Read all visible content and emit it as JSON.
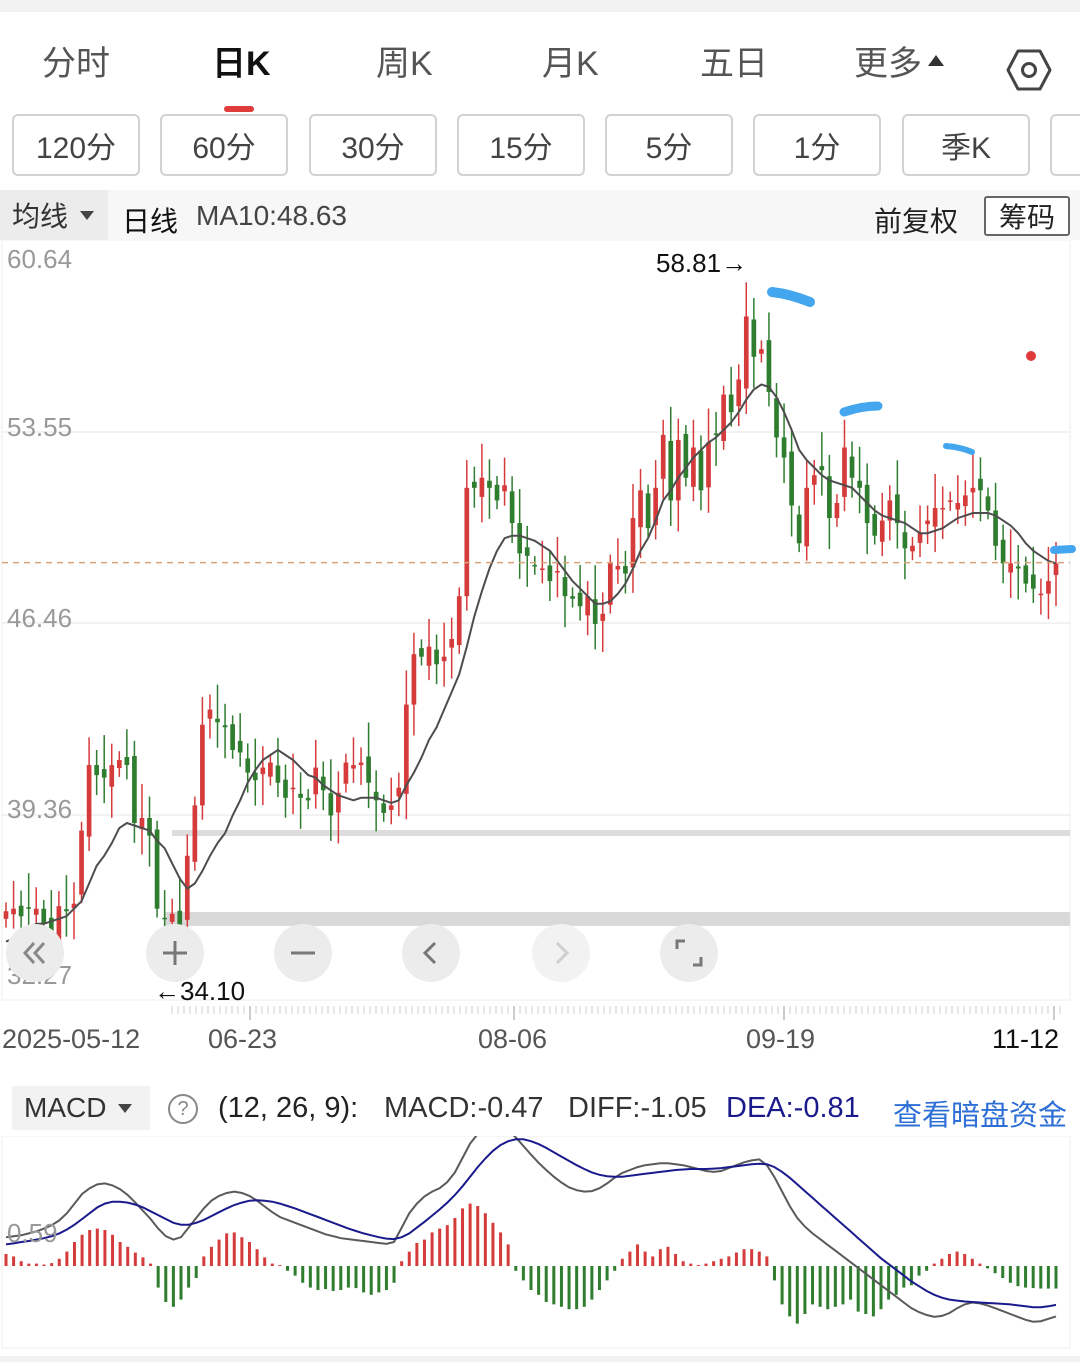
{
  "tabs": [
    {
      "label": "分时"
    },
    {
      "label": "日K",
      "active": true
    },
    {
      "label": "周K"
    },
    {
      "label": "月K"
    },
    {
      "label": "五日"
    },
    {
      "label": "更多"
    }
  ],
  "periods": [
    "120分",
    "60分",
    "30分",
    "15分",
    "5分",
    "1分",
    "季K"
  ],
  "info": {
    "select_label": "均线",
    "kline_label": "日线",
    "ma_label": "MA10:48.63",
    "adjust_label": "前复权",
    "chips_label": "筹码"
  },
  "macd": {
    "select_label": "MACD",
    "params": "(12, 26, 9):",
    "macd_value": "MACD:-0.47",
    "diff_value": "DIFF:-1.05",
    "dea_value": "DEA:-0.81",
    "link_label": "查看暗盘资金"
  },
  "colors": {
    "up": "#d63b3b",
    "down": "#2f7d2f",
    "ma": "#4d4d4d",
    "dea": "#1a1a8c",
    "link": "#2d6fd6",
    "marker": "#44a6ee"
  },
  "icons": {
    "settings": "hexagon-gear-icon",
    "rewind": "double-left-icon",
    "zoom_in": "plus-icon",
    "zoom_out": "minus-icon",
    "prev": "left-icon",
    "next": "right-icon",
    "fullscreen": "fullscreen-icon"
  },
  "chart_data": [
    {
      "type": "candlestick",
      "title": "日K",
      "y_tick_labels": [
        "60.64",
        "53.55",
        "46.46",
        "39.36",
        "32.27"
      ],
      "ylim": [
        32.27,
        60.64
      ],
      "x_tick_labels": [
        "2025-05-12",
        "06-23",
        "08-06",
        "09-19",
        "11-12"
      ],
      "annotations": {
        "high": "58.81→",
        "low": "←34.10",
        "high_value": 58.81,
        "low_value": 34.1
      },
      "last_close": 48.63,
      "ma10_last": 48.63,
      "closes": [
        34.8,
        34.9,
        34.6,
        34.9,
        34.9,
        34.3,
        34.0,
        35.0,
        34.8,
        35.1,
        38.0,
        40.6,
        40.2,
        40.1,
        40.6,
        40.8,
        40.6,
        38.3,
        38.5,
        37.8,
        34.9,
        34.5,
        34.7,
        34.1,
        37.0,
        39.0,
        42.2,
        42.8,
        42.3,
        42.1,
        41.2,
        41.1,
        40.3,
        40.0,
        40.5,
        40.7,
        39.9,
        39.3,
        39.7,
        39.3,
        39.2,
        40.5,
        39.6,
        38.6,
        39.5,
        40.7,
        40.6,
        40.7,
        39.9,
        39.2,
        38.7,
        39.0,
        39.7,
        43.0,
        45.0,
        44.9,
        45.3,
        44.6,
        44.9,
        45.6,
        47.3,
        51.6,
        51.6,
        52.0,
        51.6,
        51.1,
        51.7,
        50.2,
        49.0,
        48.9,
        48.5,
        48.4,
        47.9,
        48.3,
        47.3,
        47.2,
        46.9,
        47.3,
        46.2,
        46.6,
        48.6,
        48.5,
        48.2,
        50.4,
        51.5,
        50.0,
        51.6,
        53.7,
        51.1,
        53.5,
        52.0,
        53.2,
        51.5,
        53.4,
        53.7,
        55.3,
        54.6,
        55.9,
        58.4,
        56.8,
        57.1,
        55.4,
        53.6,
        52.8,
        50.9,
        49.4,
        51.6,
        52.1,
        52.3,
        50.4,
        51.0,
        53.2,
        52.0,
        51.6,
        50.2,
        49.7,
        50.3,
        51.1,
        50.2,
        49.2,
        49.3,
        49.8,
        50.3,
        50.8,
        50.8,
        51.1,
        51.0,
        51.3,
        51.6,
        51.5,
        50.7,
        49.3,
        48.6,
        48.6,
        48.4,
        47.8,
        47.6,
        47.4,
        47.9,
        48.6
      ],
      "ma10": [
        33.6,
        33.7,
        33.9,
        34.1,
        34.3,
        34.3,
        34.4,
        34.5,
        34.6,
        34.9,
        35.2,
        35.9,
        36.6,
        37.0,
        37.5,
        38.1,
        38.3,
        38.2,
        38.1,
        38.0,
        37.6,
        37.3,
        36.7,
        36.1,
        35.7,
        35.9,
        36.4,
        37.0,
        37.5,
        37.9,
        38.6,
        39.2,
        39.9,
        40.4,
        40.8,
        41.0,
        41.2,
        41.0,
        40.8,
        40.5,
        40.2,
        40.1,
        39.8,
        39.6,
        39.4,
        39.3,
        39.2,
        39.3,
        39.3,
        39.3,
        39.2,
        39.1,
        39.2,
        39.8,
        40.3,
        40.9,
        41.6,
        42.1,
        42.8,
        43.5,
        44.2,
        45.3,
        46.5,
        47.5,
        48.4,
        49.1,
        49.6,
        49.7,
        49.7,
        49.6,
        49.5,
        49.3,
        49.1,
        48.7,
        48.3,
        47.9,
        47.6,
        47.3,
        47.0,
        47.0,
        47.1,
        47.4,
        47.8,
        48.4,
        49.1,
        49.6,
        50.3,
        51.1,
        51.5,
        52.0,
        52.4,
        52.8,
        53.1,
        53.4,
        53.6,
        53.9,
        54.2,
        54.6,
        55.1,
        55.5,
        55.7,
        55.6,
        55.2,
        54.6,
        53.9,
        53.1,
        52.7,
        52.4,
        52.1,
        51.9,
        51.8,
        51.7,
        51.6,
        51.3,
        51.0,
        50.7,
        50.5,
        50.4,
        50.3,
        50.2,
        50.0,
        49.8,
        49.8,
        49.9,
        50.0,
        50.2,
        50.4,
        50.5,
        50.6,
        50.6,
        50.6,
        50.5,
        50.3,
        50.1,
        49.8,
        49.4,
        49.1,
        48.9,
        48.7,
        48.6
      ],
      "series": [
        {
          "name": "MA10",
          "values_key": "ma10"
        }
      ]
    },
    {
      "type": "bar+line",
      "title": "MACD",
      "y_tick_labels": [
        "0.59"
      ],
      "series": [
        {
          "name": "MACD",
          "last": -0.47
        },
        {
          "name": "DIFF",
          "last": -1.05
        },
        {
          "name": "DEA",
          "last": -0.81
        }
      ],
      "macd_hist": [
        0.25,
        0.2,
        0.1,
        0.05,
        0.05,
        0.03,
        0.06,
        0.15,
        0.3,
        0.5,
        0.65,
        0.75,
        0.78,
        0.75,
        0.65,
        0.5,
        0.4,
        0.28,
        0.18,
        0.05,
        -0.45,
        -0.75,
        -0.85,
        -0.7,
        -0.45,
        -0.25,
        0.2,
        0.4,
        0.55,
        0.68,
        0.7,
        0.6,
        0.5,
        0.35,
        0.18,
        0.05,
        0.02,
        -0.1,
        -0.2,
        -0.35,
        -0.45,
        -0.5,
        -0.48,
        -0.52,
        -0.5,
        -0.45,
        -0.46,
        -0.55,
        -0.6,
        -0.55,
        -0.5,
        -0.35,
        0.1,
        0.3,
        0.48,
        0.55,
        0.7,
        0.78,
        0.85,
        1.0,
        1.2,
        1.3,
        1.25,
        1.1,
        0.9,
        0.7,
        0.45,
        -0.1,
        -0.3,
        -0.5,
        -0.6,
        -0.75,
        -0.8,
        -0.85,
        -0.9,
        -0.9,
        -0.85,
        -0.7,
        -0.5,
        -0.3,
        -0.1,
        0.15,
        0.3,
        0.45,
        0.3,
        0.2,
        0.35,
        0.4,
        0.25,
        0.1,
        0.05,
        0.02,
        0.05,
        0.1,
        0.15,
        0.2,
        0.28,
        0.35,
        0.35,
        0.3,
        0.2,
        -0.3,
        -0.8,
        -1.05,
        -1.2,
        -1.0,
        -0.8,
        -0.85,
        -0.9,
        -0.85,
        -0.8,
        -0.7,
        -0.95,
        -1.0,
        -1.05,
        -0.9,
        -0.7,
        -0.6,
        -0.45,
        -0.4,
        -0.2,
        -0.1,
        0.05,
        0.15,
        0.25,
        0.3,
        0.25,
        0.15,
        0.05,
        -0.05,
        -0.15,
        -0.25,
        -0.35,
        -0.42,
        -0.45,
        -0.46,
        -0.47,
        -0.47,
        -0.47
      ],
      "diff": [
        0.6,
        0.62,
        0.64,
        0.68,
        0.72,
        0.78,
        0.85,
        0.95,
        1.1,
        1.3,
        1.5,
        1.62,
        1.7,
        1.72,
        1.68,
        1.6,
        1.48,
        1.32,
        1.15,
        0.98,
        0.78,
        0.62,
        0.55,
        0.6,
        0.8,
        1.0,
        1.2,
        1.36,
        1.46,
        1.52,
        1.55,
        1.52,
        1.46,
        1.36,
        1.24,
        1.12,
        1.02,
        0.96,
        0.9,
        0.84,
        0.78,
        0.72,
        0.66,
        0.62,
        0.58,
        0.56,
        0.54,
        0.52,
        0.5,
        0.48,
        0.46,
        0.5,
        0.8,
        1.1,
        1.3,
        1.45,
        1.55,
        1.62,
        1.75,
        1.95,
        2.25,
        2.55,
        2.75,
        2.88,
        2.92,
        2.9,
        2.82,
        2.68,
        2.5,
        2.32,
        2.15,
        2.0,
        1.86,
        1.74,
        1.64,
        1.58,
        1.55,
        1.56,
        1.62,
        1.72,
        1.84,
        1.94,
        2.0,
        2.06,
        2.1,
        2.12,
        2.14,
        2.14,
        2.12,
        2.1,
        2.06,
        2.02,
        1.98,
        1.96,
        1.98,
        2.04,
        2.1,
        2.16,
        2.2,
        2.22,
        2.1,
        1.85,
        1.55,
        1.25,
        1.0,
        0.82,
        0.68,
        0.56,
        0.44,
        0.32,
        0.2,
        0.08,
        -0.04,
        -0.16,
        -0.28,
        -0.4,
        -0.52,
        -0.64,
        -0.76,
        -0.88,
        -0.96,
        -1.02,
        -1.06,
        -1.04,
        -0.98,
        -0.88,
        -0.8,
        -0.76,
        -0.78,
        -0.82,
        -0.88,
        -0.94,
        -1.0,
        -1.06,
        -1.12,
        -1.16,
        -1.15,
        -1.1,
        -1.05
      ],
      "dea": [
        0.45,
        0.47,
        0.5,
        0.52,
        0.55,
        0.58,
        0.62,
        0.68,
        0.76,
        0.86,
        0.98,
        1.1,
        1.22,
        1.3,
        1.34,
        1.34,
        1.32,
        1.28,
        1.22,
        1.14,
        1.06,
        0.98,
        0.9,
        0.86,
        0.86,
        0.9,
        0.96,
        1.04,
        1.12,
        1.2,
        1.27,
        1.32,
        1.36,
        1.37,
        1.36,
        1.34,
        1.3,
        1.25,
        1.2,
        1.14,
        1.08,
        1.02,
        0.96,
        0.9,
        0.84,
        0.78,
        0.73,
        0.68,
        0.64,
        0.6,
        0.57,
        0.56,
        0.6,
        0.68,
        0.8,
        0.92,
        1.05,
        1.18,
        1.32,
        1.48,
        1.66,
        1.86,
        2.06,
        2.24,
        2.4,
        2.52,
        2.6,
        2.64,
        2.64,
        2.6,
        2.54,
        2.46,
        2.37,
        2.28,
        2.19,
        2.1,
        2.02,
        1.95,
        1.9,
        1.87,
        1.86,
        1.86,
        1.88,
        1.9,
        1.92,
        1.94,
        1.96,
        1.98,
        2.0,
        2.01,
        2.02,
        2.02,
        2.02,
        2.03,
        2.04,
        2.06,
        2.08,
        2.1,
        2.12,
        2.13,
        2.12,
        2.06,
        1.96,
        1.84,
        1.7,
        1.56,
        1.42,
        1.28,
        1.14,
        1.0,
        0.86,
        0.72,
        0.58,
        0.44,
        0.3,
        0.16,
        0.04,
        -0.08,
        -0.2,
        -0.32,
        -0.42,
        -0.52,
        -0.6,
        -0.66,
        -0.7,
        -0.72,
        -0.74,
        -0.75,
        -0.76,
        -0.77,
        -0.78,
        -0.79,
        -0.8,
        -0.82,
        -0.84,
        -0.86,
        -0.86,
        -0.84,
        -0.81
      ]
    }
  ]
}
